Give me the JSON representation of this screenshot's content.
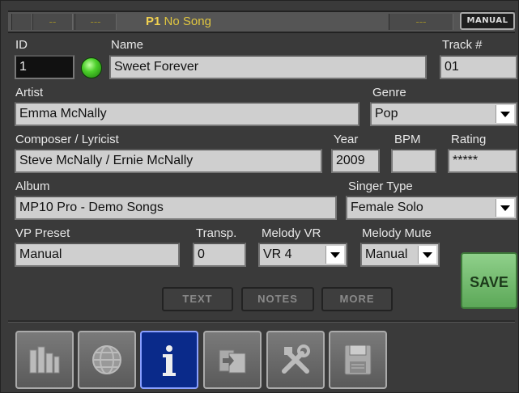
{
  "topbar": {
    "seg1": "--",
    "seg2": "---",
    "player": "P1",
    "song": "No Song",
    "seg3": "---",
    "mode_button": "MANUAL"
  },
  "fields": {
    "id_label": "ID",
    "id_value": "1",
    "name_label": "Name",
    "name_value": "Sweet Forever",
    "track_label": "Track #",
    "track_value": "01",
    "artist_label": "Artist",
    "artist_value": "Emma McNally",
    "genre_label": "Genre",
    "genre_value": "Pop",
    "composer_label": "Composer / Lyricist",
    "composer_value": "Steve McNally / Ernie McNally",
    "year_label": "Year",
    "year_value": "2009",
    "bpm_label": "BPM",
    "bpm_value": "",
    "rating_label": "Rating",
    "rating_value": "*****",
    "album_label": "Album",
    "album_value": "MP10 Pro - Demo Songs",
    "singer_label": "Singer Type",
    "singer_value": "Female Solo",
    "vp_label": "VP Preset",
    "vp_value": "Manual",
    "transp_label": "Transp.",
    "transp_value": "0",
    "melody_vr_label": "Melody VR",
    "melody_vr_value": "VR 4",
    "melody_mute_label": "Melody Mute",
    "melody_mute_value": "Manual"
  },
  "buttons": {
    "save": "SAVE",
    "text": "TEXT",
    "notes": "NOTES",
    "more": "MORE"
  },
  "nav": {
    "icons": [
      "library-icon",
      "globe-icon",
      "info-icon",
      "export-icon",
      "tools-icon",
      "disk-icon"
    ],
    "active_color": "#0a2a8a"
  }
}
